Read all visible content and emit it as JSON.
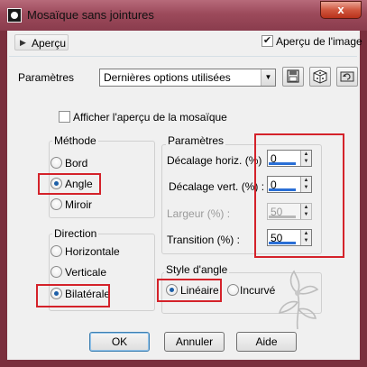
{
  "window": {
    "title": "Mosaïque sans jointures",
    "close_glyph": "x"
  },
  "toolbar": {
    "apercu_label": "Aperçu",
    "apercu_image_label": "Aperçu de l'image",
    "apercu_image_checked": true
  },
  "parametres_row": {
    "label": "Paramètres",
    "selected_value": "Dernières options utilisées"
  },
  "afficher_apercu": {
    "label": "Afficher l'aperçu de la mosaïque",
    "checked": false
  },
  "methode": {
    "title": "Méthode",
    "options": [
      {
        "label": "Bord",
        "selected": false
      },
      {
        "label": "Angle",
        "selected": true
      },
      {
        "label": "Miroir",
        "selected": false
      }
    ]
  },
  "direction": {
    "title": "Direction",
    "options": [
      {
        "label": "Horizontale",
        "selected": false
      },
      {
        "label": "Verticale",
        "selected": false
      },
      {
        "label": "Bilatérale",
        "selected": true
      }
    ]
  },
  "parametres": {
    "title": "Paramètres",
    "fields": [
      {
        "label": "Décalage horiz. (%)",
        "value": "0",
        "enabled": true
      },
      {
        "label": "Décalage vert. (%) :",
        "value": "0",
        "enabled": true
      },
      {
        "label": "Largeur (%) :",
        "value": "50",
        "enabled": false
      },
      {
        "label": "Transition (%) :",
        "value": "50",
        "enabled": true
      }
    ]
  },
  "style_angle": {
    "title": "Style d'angle",
    "options": [
      {
        "label": "Linéaire",
        "selected": true
      },
      {
        "label": "Incurvé",
        "selected": false
      }
    ]
  },
  "buttons": {
    "ok": "OK",
    "cancel": "Annuler",
    "help": "Aide"
  },
  "colors": {
    "highlight": "#d4222a",
    "title_bar": "#9c4a5b",
    "accent": "#2a6fd6"
  }
}
